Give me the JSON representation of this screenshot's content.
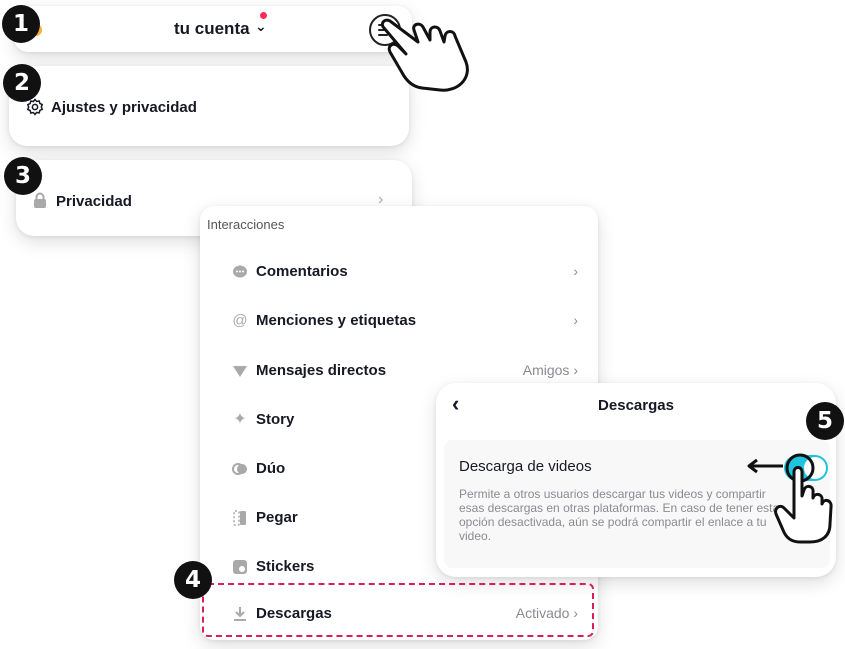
{
  "steps": [
    "1",
    "2",
    "3",
    "4",
    "5"
  ],
  "top_bar": {
    "title": "tu cuenta",
    "chevron": "⌄",
    "menu_icon": "hamburger-menu-icon"
  },
  "settings_card": {
    "label": "Ajustes y privacidad",
    "icon": "gear-icon"
  },
  "privacy_card": {
    "label": "Privacidad",
    "icon": "lock-icon",
    "arrow": "›"
  },
  "interactions": {
    "section_title": "Interacciones",
    "items": [
      {
        "label": "Comentarios",
        "value": "",
        "arrow": "›",
        "icon": "comment-icon"
      },
      {
        "label": "Menciones y etiquetas",
        "value": "",
        "arrow": "›",
        "icon": "at-icon"
      },
      {
        "label": "Mensajes directos",
        "value": "Amigos",
        "arrow": "›",
        "icon": "send-icon"
      },
      {
        "label": "Story",
        "value": "",
        "arrow": "",
        "icon": "sparkle-icon"
      },
      {
        "label": "Dúo",
        "value": "",
        "arrow": "",
        "icon": "duet-icon"
      },
      {
        "label": "Pegar",
        "value": "",
        "arrow": "",
        "icon": "stitch-icon"
      },
      {
        "label": "Stickers",
        "value": "",
        "arrow": "",
        "icon": "sticker-icon"
      },
      {
        "label": "Descargas",
        "value": "Activado",
        "arrow": "›",
        "icon": "download-icon"
      }
    ]
  },
  "downloads_panel": {
    "back": "‹",
    "title": "Descargas",
    "option_label": "Descarga de videos",
    "description": "Permite a otros usuarios descargar tus videos y compartir esas descargas en otras plataformas. En caso de tener esta opción desactivada, aún se podrá compartir el enlace a tu video.",
    "toggle_on": true
  },
  "colors": {
    "accent_toggle": "#21c4de",
    "highlight": "#d61f5b",
    "notification": "#fe2c55"
  }
}
